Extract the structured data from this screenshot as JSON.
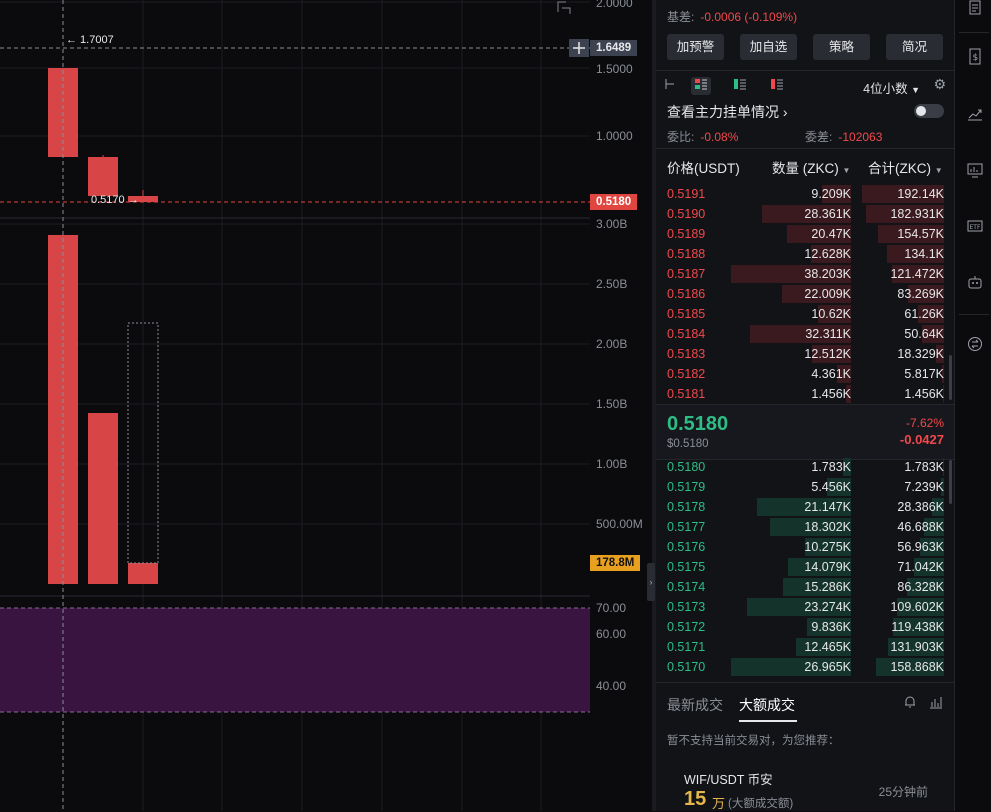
{
  "chart": {
    "price_axis": [
      "2.0000",
      "1.5000",
      "1.0000"
    ],
    "volume_axis": [
      "3.00B",
      "2.50B",
      "2.00B",
      "1.50B",
      "1.00B",
      "500.00M"
    ],
    "indicator_axis": [
      "70.00",
      "60.00",
      "40.00"
    ],
    "crosshair_price_tag": "1.6489",
    "last_price_tag": "0.5180",
    "volume_tag": "178.8M",
    "high_note": "← 1.7007",
    "low_note": "0.5170 →",
    "colors": {
      "up": "#d84547",
      "price_tag": "#e0463f",
      "volume_tag": "#e8a020",
      "indicator_zone": "#3a1440"
    }
  },
  "panel": {
    "basis_label": "基差:",
    "basis_value": "-0.0006 (-0.109%)",
    "buttons": [
      "加预警",
      "加自选",
      "策略",
      "简况"
    ],
    "decimal_select": "4位小数",
    "main_force_label": "查看主力挂单情况",
    "ratio_label": "委比:",
    "ratio_value": "-0.08%",
    "diff_label": "委差:",
    "diff_value": "-102063",
    "col_price": "价格(USDT)",
    "col_qty": "数量 (ZKC)",
    "col_total": "合计(ZKC)",
    "asks": [
      {
        "p": "0.5191",
        "q": "9.209K",
        "t": "192.14K"
      },
      {
        "p": "0.5190",
        "q": "28.361K",
        "t": "182.931K"
      },
      {
        "p": "0.5189",
        "q": "20.47K",
        "t": "154.57K"
      },
      {
        "p": "0.5188",
        "q": "12.628K",
        "t": "134.1K"
      },
      {
        "p": "0.5187",
        "q": "38.203K",
        "t": "121.472K"
      },
      {
        "p": "0.5186",
        "q": "22.009K",
        "t": "83.269K"
      },
      {
        "p": "0.5185",
        "q": "10.62K",
        "t": "61.26K"
      },
      {
        "p": "0.5184",
        "q": "32.311K",
        "t": "50.64K"
      },
      {
        "p": "0.5183",
        "q": "12.512K",
        "t": "18.329K"
      },
      {
        "p": "0.5182",
        "q": "4.361K",
        "t": "5.817K"
      },
      {
        "p": "0.5181",
        "q": "1.456K",
        "t": "1.456K"
      }
    ],
    "mid_price": "0.5180",
    "mid_usd": "$0.5180",
    "mid_pct": "-7.62%",
    "mid_change": "-0.0427",
    "bids": [
      {
        "p": "0.5180",
        "q": "1.783K",
        "t": "1.783K"
      },
      {
        "p": "0.5179",
        "q": "5.456K",
        "t": "7.239K"
      },
      {
        "p": "0.5178",
        "q": "21.147K",
        "t": "28.386K"
      },
      {
        "p": "0.5177",
        "q": "18.302K",
        "t": "46.688K"
      },
      {
        "p": "0.5176",
        "q": "10.275K",
        "t": "56.963K"
      },
      {
        "p": "0.5175",
        "q": "14.079K",
        "t": "71.042K"
      },
      {
        "p": "0.5174",
        "q": "15.286K",
        "t": "86.328K"
      },
      {
        "p": "0.5173",
        "q": "23.274K",
        "t": "109.602K"
      },
      {
        "p": "0.5172",
        "q": "9.836K",
        "t": "119.438K"
      },
      {
        "p": "0.5171",
        "q": "12.465K",
        "t": "131.903K"
      },
      {
        "p": "0.5170",
        "q": "26.965K",
        "t": "158.868K"
      }
    ],
    "tab_latest": "最新成交",
    "tab_large": "大额成交",
    "notice": "暂不支持当前交易对，为您推荐：",
    "card_pair": "WIF/USDT 币安",
    "card_time": "25分钟前",
    "card_amount": "15",
    "card_unit": "万",
    "card_sub": "(大额成交额)"
  },
  "sidebar": {
    "icons": [
      "document-icon",
      "dollar-doc-icon",
      "trend-icon",
      "monitor-chart-icon",
      "etf-icon",
      "bot-icon",
      "swap-icon"
    ]
  }
}
